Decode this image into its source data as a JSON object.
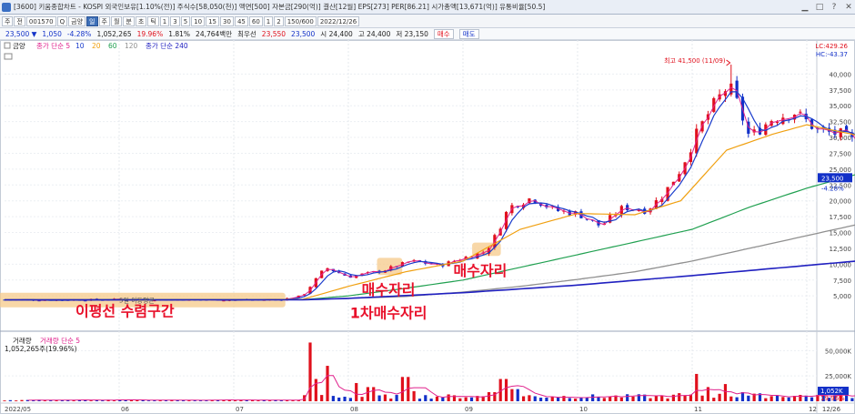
{
  "window": {
    "title": "[3600] 키움종합차트 - KOSPI 외국인보유[1.10%(전)] 주식수[58,050(천)] 액면[500] 자본금[290(억)] 결산[12월] EPS[273] PER[86.21] 시가총액[13,671(억)] 유통비율[50.5]",
    "buttons": [
      "▁",
      "□",
      "?",
      "✕"
    ]
  },
  "toolbar": {
    "items": [
      "주",
      "전",
      "001570",
      "Q",
      "금양",
      "일",
      "주",
      "월",
      "분",
      "초",
      "틱",
      "1",
      "3",
      "5",
      "10",
      "15",
      "30",
      "45",
      "60",
      "1",
      "2",
      "150/600",
      "2022/12/26"
    ],
    "active": "일"
  },
  "quote": {
    "price": "23,500 ▼",
    "change": "1,050",
    "change_pct": "-4.28%",
    "volume": "1,052,265",
    "turnover_pct": "19.96%",
    "ratio": "1.81%",
    "amount": "24,764백만",
    "prev_label": "최우선",
    "ask": "23,550",
    "bid": "23,500",
    "open": "시 24,400",
    "high": "고 24,400",
    "low": "저 23,150",
    "buy": "매수",
    "sell": "매도"
  },
  "colors": {
    "up": "#e0101c",
    "down": "#1230c8",
    "ma5": "#e0208c",
    "ma10": "#1a3ccc",
    "ma20": "#f0a010",
    "ma60": "#20a050",
    "ma120": "#909090",
    "ma240": "#2020c0",
    "highlight": "#f6c98a"
  },
  "chart_data": [
    {
      "type": "candlestick",
      "title": "금양",
      "legend": [
        "종가 단순 5",
        "10",
        "20",
        "60",
        "120",
        "종가 단순 240"
      ],
      "x_ticks": [
        "2022/05",
        "06",
        "07",
        "08",
        "09",
        "10",
        "11",
        "12",
        "12/26"
      ],
      "ylim": [
        0,
        42500
      ],
      "y_ticks": [
        "5,000",
        "7,500",
        "10,000",
        "12,500",
        "15,000",
        "17,500",
        "20,000",
        "22,500",
        "25,000",
        "27,500",
        "30,000",
        "32,500",
        "35,000",
        "37,500",
        "40,000"
      ],
      "y_values": [
        5000,
        7500,
        10000,
        12500,
        15000,
        17500,
        20000,
        22500,
        25000,
        27500,
        30000,
        32500,
        35000,
        37500,
        40000
      ],
      "lc_label": "LC:429.26",
      "hc_label": "HC:-43.37",
      "price_tag": "23,500",
      "price_tag_pct": "-4.28%",
      "high_annotation": "최고 41,500 (11/09)",
      "high_value": 41500,
      "current_price": 23500,
      "keypoints": [
        {
          "m": 0,
          "c": 4400
        },
        {
          "m": 0.5,
          "c": 4350
        },
        {
          "m": 1.0,
          "c": 4450
        },
        {
          "m": 1.5,
          "c": 4400
        },
        {
          "m": 2.0,
          "c": 4350
        },
        {
          "m": 2.4,
          "c": 4400
        },
        {
          "m": 2.6,
          "c": 5000
        },
        {
          "m": 2.8,
          "c": 9500
        },
        {
          "m": 3.0,
          "c": 8000
        },
        {
          "m": 3.3,
          "c": 9000
        },
        {
          "m": 3.55,
          "c": 10500
        },
        {
          "m": 3.8,
          "c": 9800
        },
        {
          "m": 4.0,
          "c": 11000
        },
        {
          "m": 4.2,
          "c": 12000
        },
        {
          "m": 4.3,
          "c": 15000
        },
        {
          "m": 4.4,
          "c": 19000
        },
        {
          "m": 4.6,
          "c": 20500
        },
        {
          "m": 4.8,
          "c": 18500
        },
        {
          "m": 5.0,
          "c": 18000
        },
        {
          "m": 5.2,
          "c": 16000
        },
        {
          "m": 5.4,
          "c": 19000
        },
        {
          "m": 5.6,
          "c": 18500
        },
        {
          "m": 5.75,
          "c": 21000
        },
        {
          "m": 5.9,
          "c": 25000
        },
        {
          "m": 6.05,
          "c": 31000
        },
        {
          "m": 6.2,
          "c": 35500
        },
        {
          "m": 6.33,
          "c": 38500
        },
        {
          "m": 6.5,
          "c": 30000
        },
        {
          "m": 6.7,
          "c": 33000
        },
        {
          "m": 6.9,
          "c": 34000
        },
        {
          "m": 7.1,
          "c": 31000
        },
        {
          "m": 7.3,
          "c": 30500
        },
        {
          "m": 7.5,
          "c": 28500
        },
        {
          "m": 7.7,
          "c": 26500
        },
        {
          "m": 7.85,
          "c": 25500
        },
        {
          "m": 8.0,
          "c": 23500
        }
      ],
      "ma_trends": {
        "ma20": [
          [
            0,
            4400
          ],
          [
            2.6,
            4450
          ],
          [
            3.0,
            6500
          ],
          [
            3.5,
            8800
          ],
          [
            4.0,
            10500
          ],
          [
            4.5,
            15500
          ],
          [
            5.0,
            18000
          ],
          [
            5.5,
            17800
          ],
          [
            5.9,
            20000
          ],
          [
            6.3,
            28000
          ],
          [
            6.7,
            30500
          ],
          [
            7.0,
            32000
          ],
          [
            7.4,
            30500
          ],
          [
            7.7,
            29000
          ],
          [
            8.0,
            27500
          ]
        ],
        "ma60": [
          [
            0,
            4380
          ],
          [
            2.6,
            4400
          ],
          [
            3.0,
            5000
          ],
          [
            3.5,
            6200
          ],
          [
            4.0,
            7500
          ],
          [
            4.5,
            9500
          ],
          [
            5.0,
            11500
          ],
          [
            5.5,
            13500
          ],
          [
            6.0,
            15500
          ],
          [
            6.5,
            19000
          ],
          [
            7.0,
            22000
          ],
          [
            7.5,
            24500
          ],
          [
            8.0,
            25500
          ]
        ],
        "ma120": [
          [
            0,
            4370
          ],
          [
            2.6,
            4390
          ],
          [
            3.5,
            4900
          ],
          [
            4.0,
            5600
          ],
          [
            4.5,
            6500
          ],
          [
            5.0,
            7600
          ],
          [
            5.5,
            8800
          ],
          [
            6.0,
            10500
          ],
          [
            6.5,
            12500
          ],
          [
            7.0,
            14500
          ],
          [
            7.5,
            16500
          ],
          [
            8.0,
            18000
          ]
        ],
        "ma240": [
          [
            0,
            4360
          ],
          [
            2.6,
            4380
          ],
          [
            3.0,
            4600
          ],
          [
            4.0,
            5500
          ],
          [
            5.0,
            6700
          ],
          [
            6.0,
            8200
          ],
          [
            6.5,
            9000
          ],
          [
            7.0,
            9800
          ],
          [
            7.5,
            10600
          ],
          [
            8.0,
            11500
          ]
        ]
      },
      "annotations": [
        {
          "text": "이평선 수렴구간",
          "m": 1.05,
          "price": 1800
        },
        {
          "text": "1차매수자리",
          "m": 3.35,
          "price": 1500
        },
        {
          "text": "매수자리",
          "m": 3.35,
          "price": 5200
        },
        {
          "text": "매수자리",
          "m": 4.15,
          "price": 8200
        }
      ],
      "highlights": [
        {
          "m0": -0.05,
          "m1": 2.45,
          "p0": 3200,
          "p1": 5500
        },
        {
          "m0": 3.25,
          "m1": 3.47,
          "p0": 8300,
          "p1": 11000
        },
        {
          "m0": 4.08,
          "m1": 4.33,
          "p0": 11300,
          "p1": 13400
        }
      ],
      "ma5_label": "5일 이동평균",
      "ma5_label_m": 1.0
    },
    {
      "type": "bar",
      "title": "거래량",
      "legend": [
        "거래량 단순 5"
      ],
      "volume_label": "1,052,265주(19.96%)",
      "ylim": [
        0,
        62000
      ],
      "y_ticks": [
        "50,000K",
        "25,000K"
      ],
      "y_values": [
        50000,
        25000
      ],
      "current_tag": "1,052K",
      "current_tag_pct": "19.96%",
      "spikes": [
        {
          "m": 2.65,
          "v": 58000
        },
        {
          "m": 2.72,
          "v": 22000
        },
        {
          "m": 2.8,
          "v": 35000
        },
        {
          "m": 3.05,
          "v": 18000
        },
        {
          "m": 3.2,
          "v": 14000
        },
        {
          "m": 3.5,
          "v": 24000
        },
        {
          "m": 3.56,
          "v": 10000
        },
        {
          "m": 4.25,
          "v": 9000
        },
        {
          "m": 4.35,
          "v": 22000
        },
        {
          "m": 4.45,
          "v": 12000
        },
        {
          "m": 4.58,
          "v": 6000
        },
        {
          "m": 5.9,
          "v": 8000
        },
        {
          "m": 6.02,
          "v": 27000
        },
        {
          "m": 6.12,
          "v": 14000
        },
        {
          "m": 6.3,
          "v": 17000
        },
        {
          "m": 6.45,
          "v": 9000
        }
      ]
    }
  ]
}
